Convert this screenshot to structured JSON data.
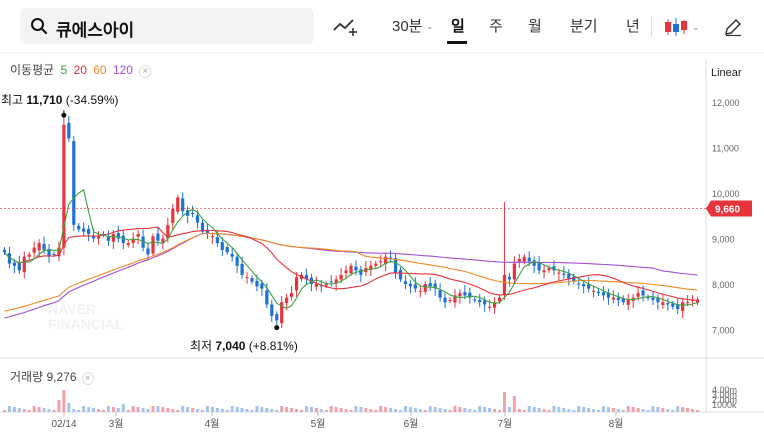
{
  "search": {
    "query": "큐에스아이"
  },
  "toolbar": {
    "interval_label": "30분",
    "periods": [
      "일",
      "주",
      "월",
      "분기",
      "년"
    ],
    "active_period": "일"
  },
  "moving_average": {
    "label": "이동평균",
    "periods": [
      {
        "value": "5",
        "color": "#3da33d"
      },
      {
        "value": "20",
        "color": "#e8333b"
      },
      {
        "value": "60",
        "color": "#f08a24"
      },
      {
        "value": "120",
        "color": "#a54fd6"
      }
    ]
  },
  "scale_mode": "Linear",
  "annotations": {
    "high_prefix": "최고",
    "high_value": "11,710",
    "high_change": "(-34.59%)",
    "low_prefix": "최저",
    "low_value": "7,040",
    "low_change": "(+8.81%)"
  },
  "current_price_label": "9,660",
  "volume": {
    "label": "거래량",
    "value": "9,276",
    "axis_ticks": [
      "4.00m",
      "3.00m",
      "2.00m",
      "1000k"
    ]
  },
  "watermark": [
    "NAVER",
    "FINANCIAL"
  ],
  "colors": {
    "up": "#e8333b",
    "down": "#1b71d6",
    "ma5": "#3da33d",
    "ma20": "#e8333b",
    "ma60": "#f08a24",
    "ma120": "#a54fd6",
    "current": "#e8333b"
  },
  "chart_data": {
    "type": "candlestick",
    "y_ticks": [
      "12,000",
      "11,000",
      "10,000",
      "9,000",
      "8,000",
      "7,000"
    ],
    "ylim": [
      6600,
      12400
    ],
    "x_labels": [
      "02/14",
      "3월",
      "4월",
      "5월",
      "6월",
      "7월",
      "8월"
    ],
    "close_series": [
      8700,
      8450,
      8400,
      8300,
      8600,
      8650,
      8800,
      8900,
      8750,
      8600,
      8650,
      8800,
      11500,
      11200,
      9300,
      9200,
      9150,
      9100,
      9000,
      9050,
      9100,
      8950,
      9100,
      9000,
      8900,
      8900,
      9000,
      9100,
      8800,
      8650,
      9050,
      8950,
      9000,
      9300,
      9650,
      9900,
      9600,
      9500,
      9550,
      9350,
      9150,
      9100,
      9050,
      8900,
      8750,
      8700,
      8600,
      8400,
      8200,
      8150,
      8050,
      7950,
      7900,
      7550,
      7300,
      7200,
      7600,
      7700,
      7800,
      8150,
      8200,
      8100,
      8000,
      8000,
      7950,
      8000,
      8050,
      8100,
      8200,
      8300,
      8400,
      8300,
      8200,
      8350,
      8400,
      8450,
      8500,
      8600,
      8550,
      8250,
      8100,
      8000,
      7950,
      7900,
      7850,
      8000,
      7950,
      7900,
      7700,
      7600,
      7650,
      7750,
      7800,
      7750,
      7700,
      7650,
      7600,
      7550,
      7500,
      7600,
      7700,
      8200,
      8100,
      8450,
      8550,
      8600,
      8500,
      8400,
      8300,
      8300,
      8350,
      8300,
      8250,
      8200,
      8100,
      8050,
      8000,
      7950,
      7900,
      7850,
      7800,
      7750,
      7700,
      7700,
      7650,
      7600,
      7650,
      7700,
      7800,
      7750,
      7700,
      7650,
      7600,
      7600,
      7550,
      7500,
      7450,
      7600,
      7600,
      7650,
      7660
    ],
    "high": 11710,
    "low": 7040,
    "current": 9660
  }
}
